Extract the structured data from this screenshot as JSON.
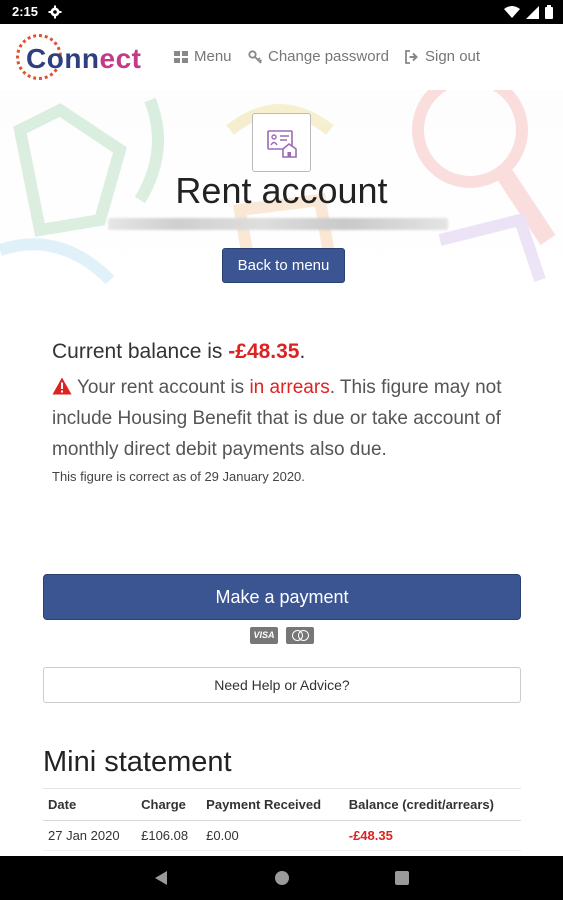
{
  "status_bar": {
    "time": "2:15"
  },
  "header": {
    "logo_text_main": "Conn",
    "logo_text_accent": "ect",
    "nav": {
      "menu_label": "Menu",
      "change_password_label": "Change password",
      "sign_out_label": "Sign out"
    }
  },
  "hero": {
    "title": "Rent account",
    "back_button_label": "Back to menu"
  },
  "balance": {
    "prefix": "Current balance is ",
    "amount": "-£48.35",
    "suffix": ".",
    "warning_before": "Your rent account is ",
    "warning_status": "in arrears",
    "warning_after": ". This figure may not include Housing Benefit that is due or take account of monthly direct debit payments also due.",
    "correct_note": "This figure is correct as of 29 January 2020."
  },
  "actions": {
    "make_payment_label": "Make a payment",
    "visa_label": "VISA",
    "help_label": "Need Help or Advice?"
  },
  "mini_statement": {
    "title": "Mini statement",
    "columns": [
      "Date",
      "Charge",
      "Payment Received",
      "Balance (credit/arrears)"
    ],
    "rows": [
      [
        "27 Jan 2020",
        "£106.08",
        "£0.00",
        "-£48.35"
      ]
    ]
  },
  "colors": {
    "primary": "#3b5593",
    "danger": "#dd2222",
    "brand_accent": "#c43a8a"
  }
}
